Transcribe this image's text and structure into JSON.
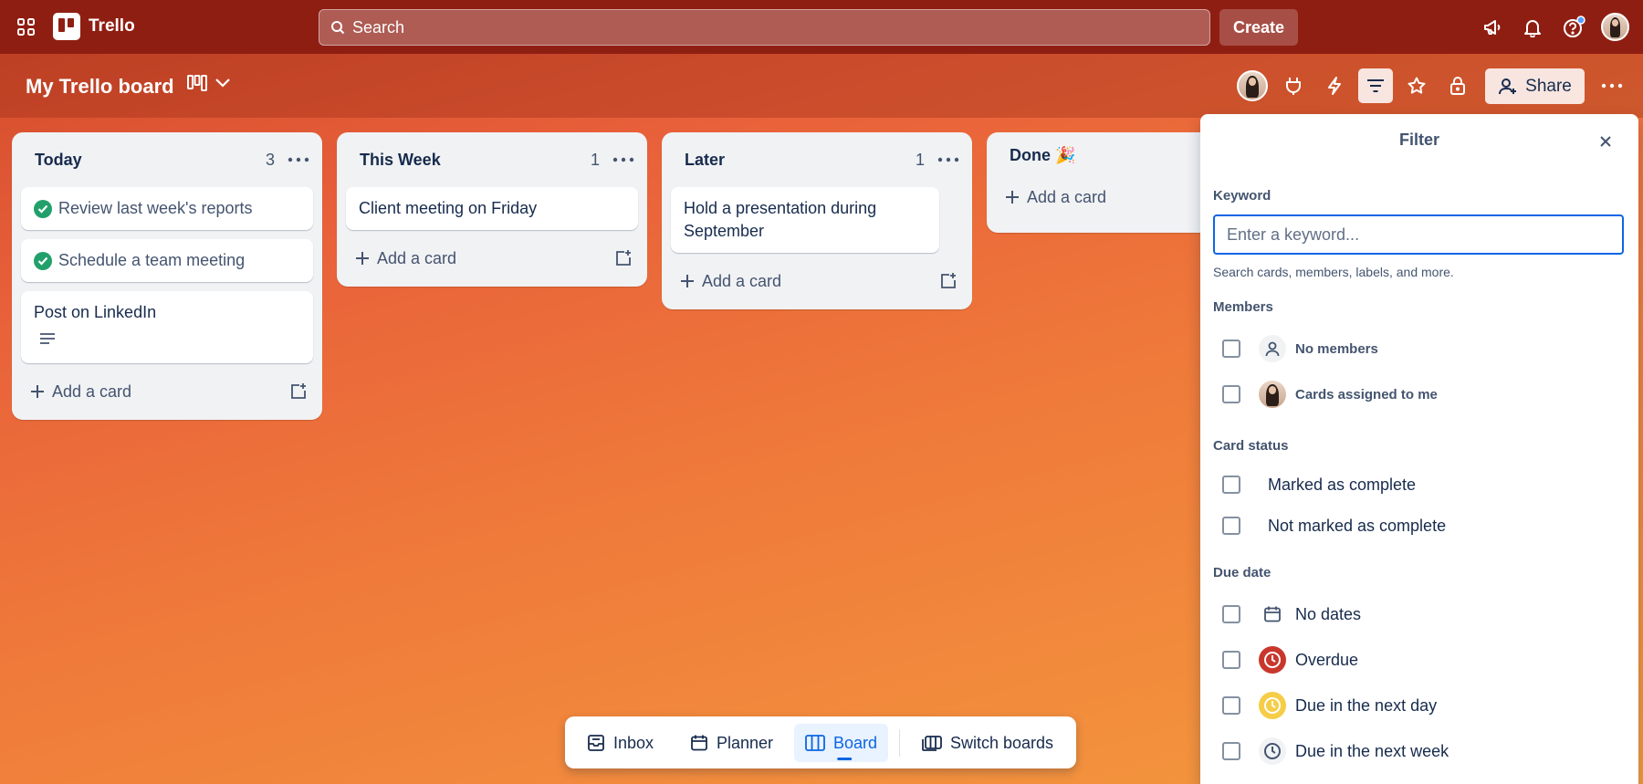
{
  "topbar": {
    "app_name": "Trello",
    "search_label": "Search",
    "create_label": "Create"
  },
  "board": {
    "title": "My Trello board",
    "share_label": "Share"
  },
  "lists": [
    {
      "title": "Today",
      "count": "3",
      "cards": [
        "Review last week's reports",
        "Schedule a team meeting",
        "Post on LinkedIn"
      ],
      "add_label": "Add a card"
    },
    {
      "title": "This Week",
      "count": "1",
      "cards": [
        "Client meeting on Friday"
      ],
      "add_label": "Add a card"
    },
    {
      "title": "Later",
      "count": "1",
      "cards": [
        "Hold a presentation during September"
      ],
      "add_label": "Add a card"
    },
    {
      "title": "Done 🎉",
      "add_label": "Add a card"
    }
  ],
  "filter": {
    "title": "Filter",
    "keyword_label": "Keyword",
    "keyword_placeholder": "Enter a keyword...",
    "keyword_help": "Search cards, members, labels, and more.",
    "members_label": "Members",
    "members": [
      "No members",
      "Cards assigned to me"
    ],
    "status_label": "Card status",
    "status": [
      "Marked as complete",
      "Not marked as complete"
    ],
    "due_label": "Due date",
    "due": [
      "No dates",
      "Overdue",
      "Due in the next day",
      "Due in the next week"
    ]
  },
  "dock": {
    "inbox": "Inbox",
    "planner": "Planner",
    "board": "Board",
    "switch": "Switch boards"
  },
  "colors": {
    "topbar": "#8f1e12",
    "accent": "#0c66e4",
    "complete": "#22a06b",
    "overdue": "#c9372c",
    "due_soon": "#f5cd47"
  }
}
